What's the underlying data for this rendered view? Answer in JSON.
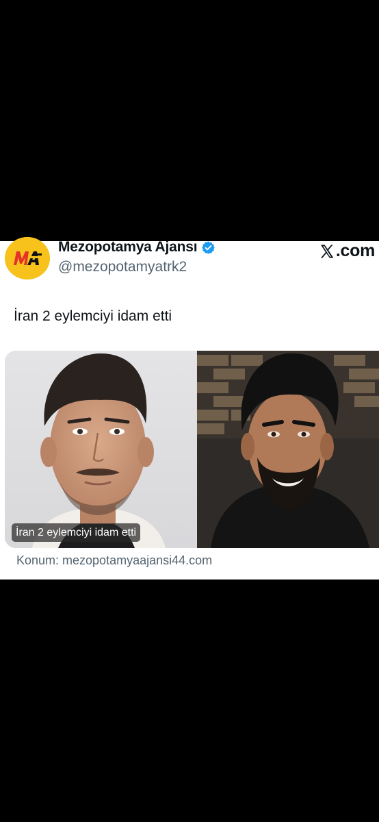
{
  "account": {
    "display_name": "Mezopotamya Ajansı",
    "handle": "@mezopotamyatrk2",
    "avatar_text": "MA",
    "verified_icon": "verified-badge-icon"
  },
  "brand": {
    "site": ".com",
    "logo_icon": "x-logo-icon"
  },
  "tweet": {
    "text": "İran 2 eylemciyi idam etti"
  },
  "media": {
    "caption": "İran 2 eylemciyi idam etti",
    "photos": [
      "portrait-photo-left",
      "portrait-photo-right"
    ]
  },
  "source": {
    "text": "Konum: mezopotamyaajansi44.com"
  },
  "colors": {
    "background": "#000000",
    "card": "#ffffff",
    "text": "#0f1419",
    "secondary_text": "#536471",
    "verified": "#1d9bf0",
    "avatar_bg": "#f7c21c",
    "avatar_red": "#e5332a"
  }
}
